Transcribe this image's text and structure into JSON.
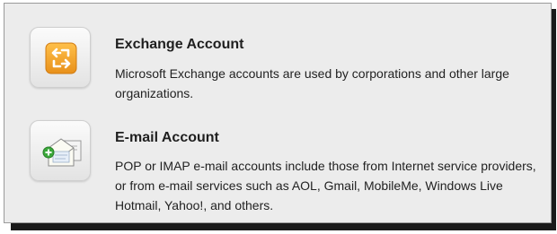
{
  "options": [
    {
      "icon": "exchange-icon",
      "title": "Exchange Account",
      "description": "Microsoft Exchange accounts are used by corporations and other large organizations."
    },
    {
      "icon": "email-icon",
      "title": "E-mail Account",
      "description": "POP or IMAP e-mail accounts include those from Internet service providers, or from e-mail services such as AOL, Gmail, MobileMe, Windows Live Hotmail, Yahoo!, and others."
    }
  ],
  "colors": {
    "exchange_orange": "#f0a020",
    "panel_background": "#ececec",
    "add_badge_green": "#3aa83a"
  }
}
